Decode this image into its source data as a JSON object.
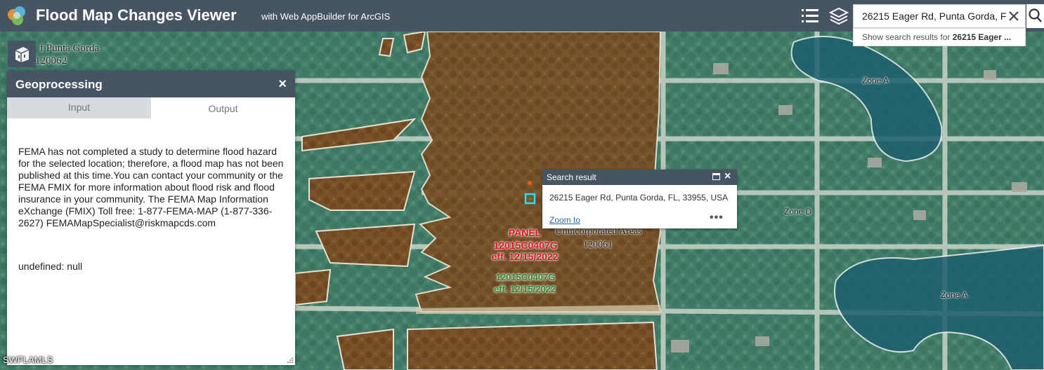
{
  "header": {
    "title": "Flood Map Changes Viewer",
    "subtitle": "with Web AppBuilder for ArcGIS",
    "search_value": "26215 Eager Rd, Punta Gorda, F",
    "suggest_prefix": "Show search results for ",
    "suggest_term": "26215 Eager ..."
  },
  "geoprocessing": {
    "title": "Geoprocessing",
    "close": "×",
    "tabs": [
      "Input",
      "Output"
    ],
    "active_tab": "Output",
    "message": "FEMA has not completed a study to determine flood hazard for the selected location; therefore, a flood map has not been published at this time.You can contact your community or the FEMA FMIX for more information about flood risk and flood insurance in your community. The FEMA Map Information eXchange (FMIX) Toll free: 1-877-FEMA-MAP (1-877-336-2627) FEMAMapSpecialist@riskmapcds.com",
    "undefined_line": "undefined: null"
  },
  "popup": {
    "title": "Search result",
    "address": "26215 Eager Rd, Punta Gorda, FL, 33955, USA",
    "zoom_to": "Zoom to",
    "more": "•••"
  },
  "map": {
    "community_label_1": "f Punta Gorda",
    "community_label_2": "120062",
    "panel_label": "PANEL",
    "panel_red_1": "12015C0407G",
    "panel_red_2": "eff. 12/15/2022",
    "panel_green_1": "12015C0407G",
    "panel_green_2": "eff. 12/15/2022",
    "area_label_1": "Unincorporated Areas",
    "area_label_2": "120061",
    "zone_a_top": "Zone A",
    "zone_d": "Zone D",
    "zone_a_bottom": "Zone A"
  },
  "watermark": "SWFLAMLS",
  "colors": {
    "header": "#475464",
    "flood_brown": "#8a5a2a",
    "zone_a_teal": "#1f6f78",
    "map_green": "#4f7a5a"
  }
}
